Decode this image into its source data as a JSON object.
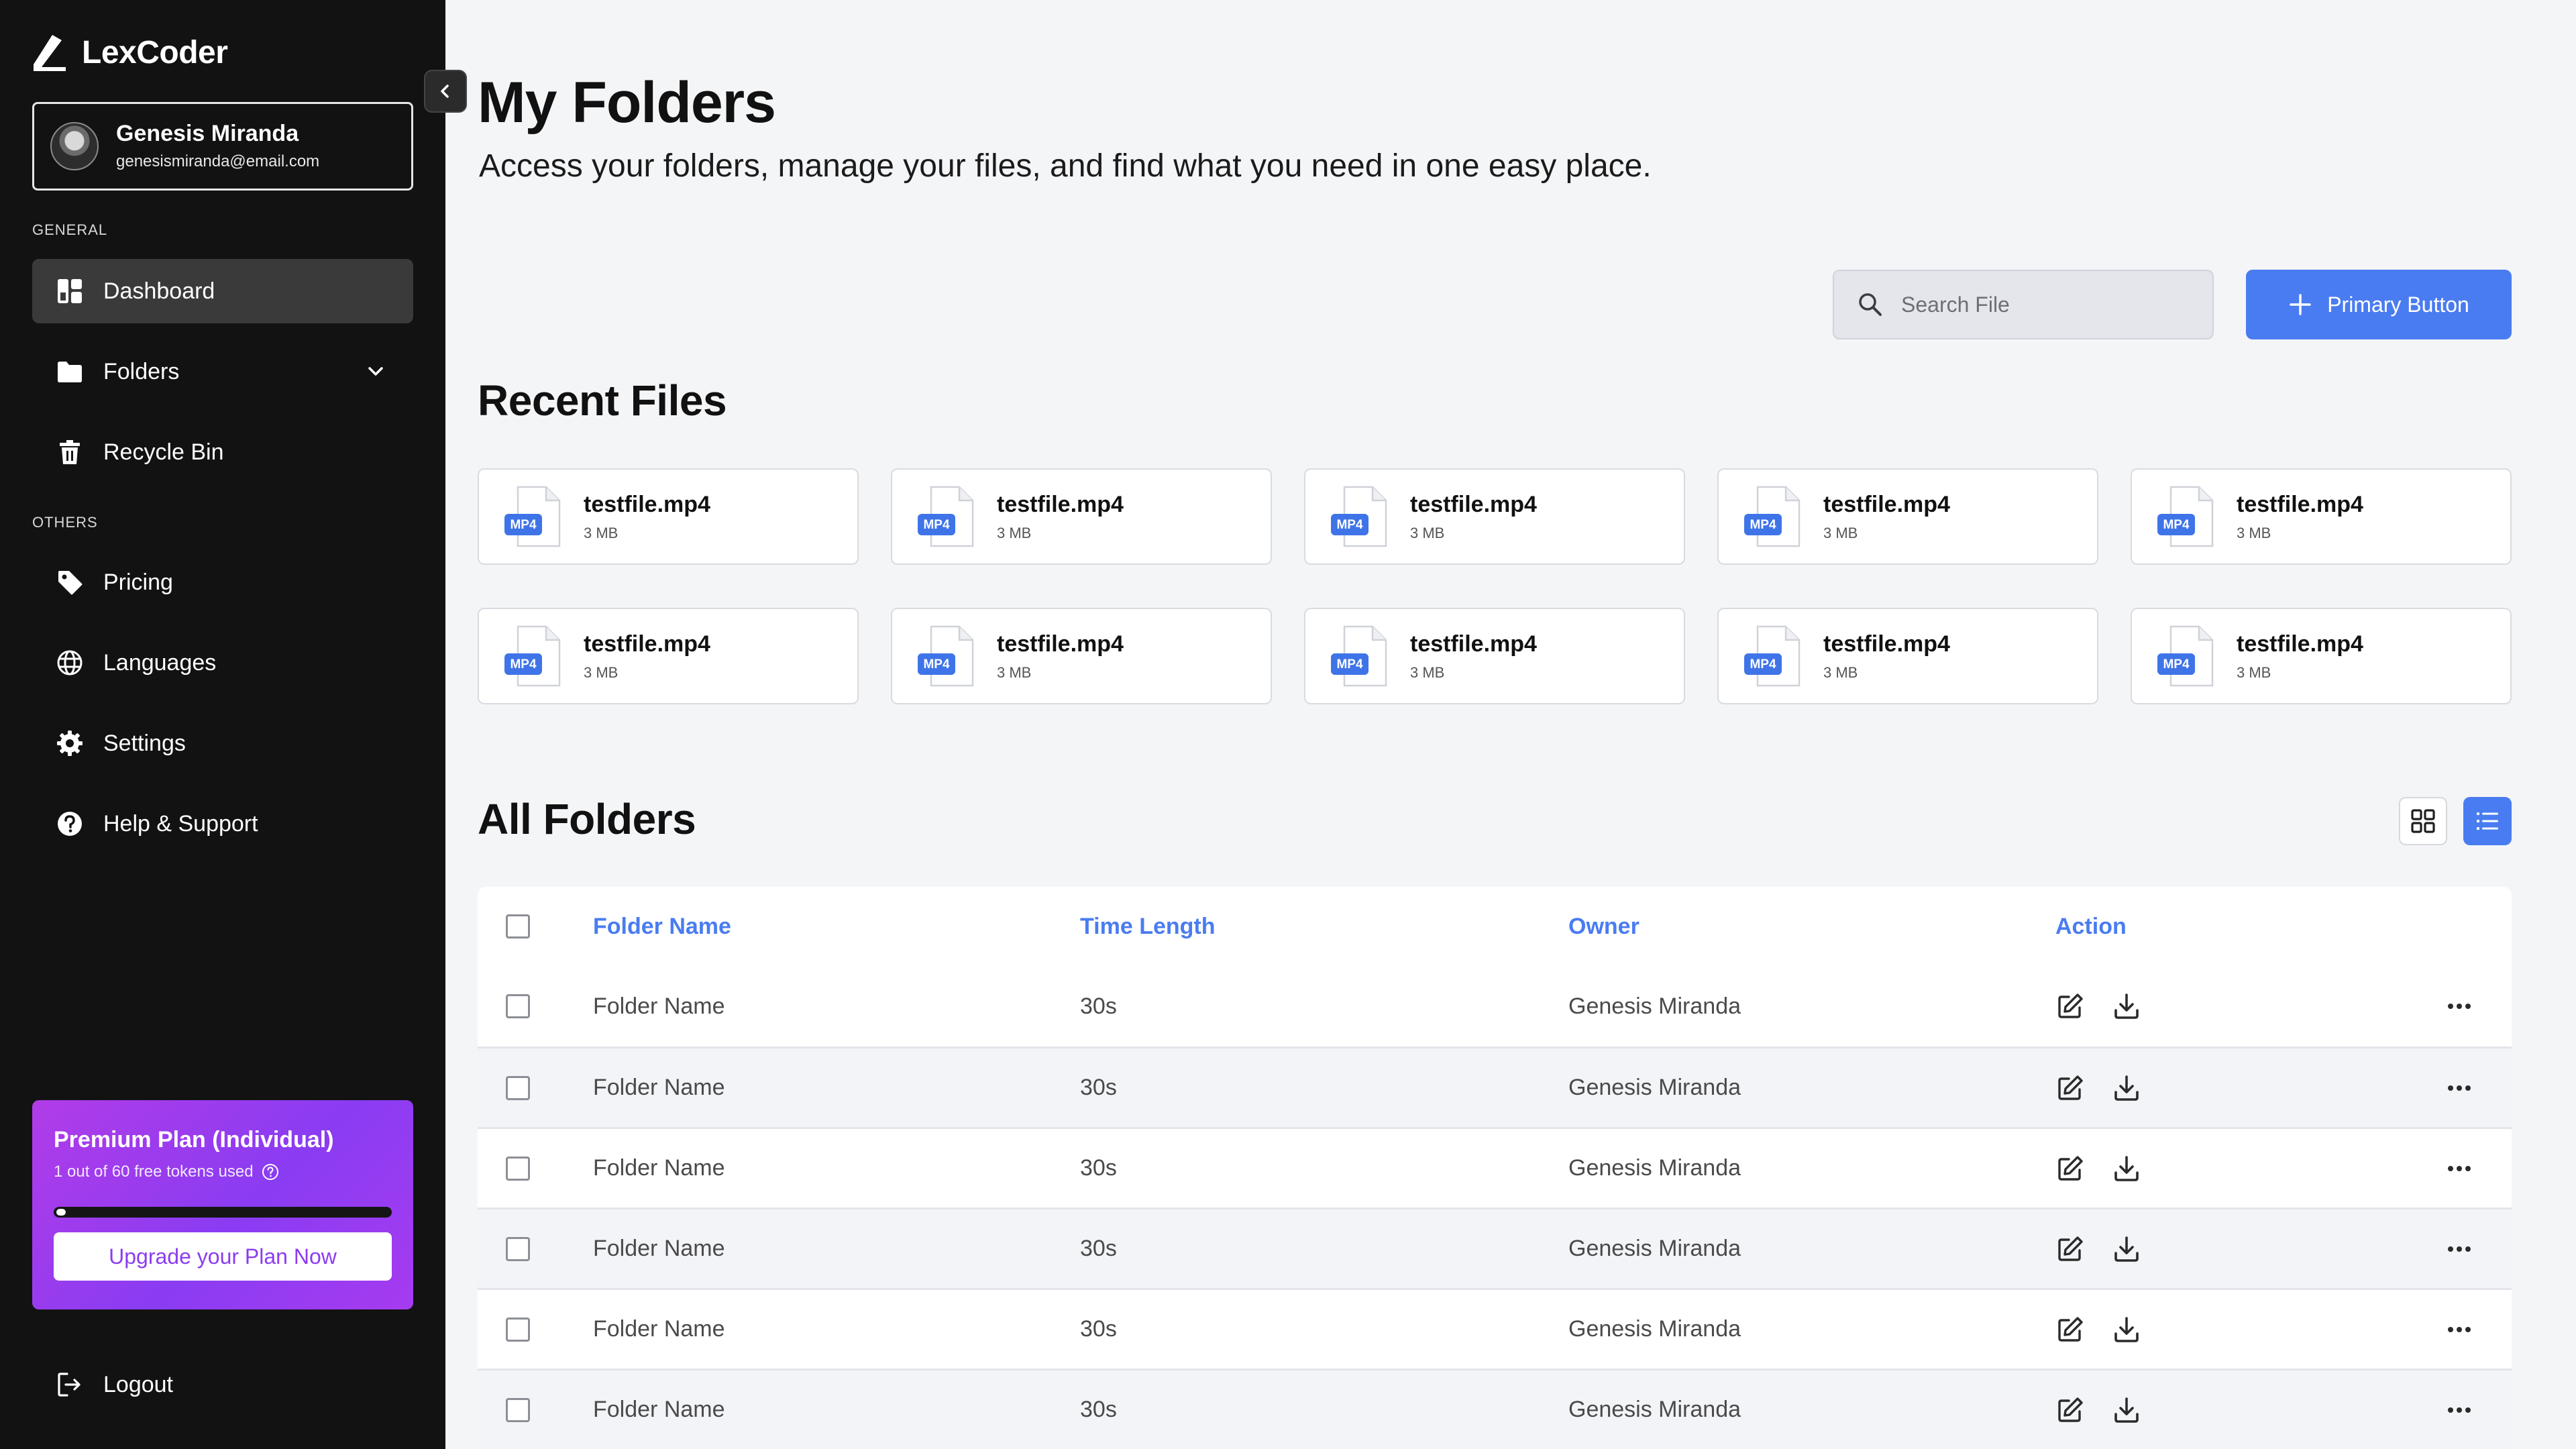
{
  "app": {
    "name": "LexCoder"
  },
  "user": {
    "name": "Genesis Miranda",
    "email": "genesismiranda@email.com"
  },
  "sidebar": {
    "general_label": "GENERAL",
    "others_label": "OTHERS",
    "items": [
      {
        "label": "Dashboard",
        "icon": "dashboard-icon",
        "active": true
      },
      {
        "label": "Folders",
        "icon": "folder-icon"
      },
      {
        "label": "Recycle Bin",
        "icon": "trash-icon"
      },
      {
        "label": "Pricing",
        "icon": "tag-icon"
      },
      {
        "label": "Languages",
        "icon": "globe-icon"
      },
      {
        "label": "Settings",
        "icon": "gear-icon"
      },
      {
        "label": "Help & Support",
        "icon": "help-icon"
      }
    ],
    "logout_label": "Logout"
  },
  "premium": {
    "title": "Premium Plan (Individual)",
    "usage_text": "1 out of 60 free tokens used",
    "tokens_used": 1,
    "tokens_total": 60,
    "button_label": "Upgrade your Plan Now"
  },
  "header": {
    "title": "My Folders",
    "subtitle": "Access your folders, manage your files, and find what you need in one easy place."
  },
  "search": {
    "placeholder": "Search File"
  },
  "primary_button": {
    "label": "Primary Button"
  },
  "recent_files": {
    "heading": "Recent Files",
    "badge": "MP4",
    "files": [
      {
        "name": "testfile.mp4",
        "size": "3 MB"
      },
      {
        "name": "testfile.mp4",
        "size": "3 MB"
      },
      {
        "name": "testfile.mp4",
        "size": "3 MB"
      },
      {
        "name": "testfile.mp4",
        "size": "3 MB"
      },
      {
        "name": "testfile.mp4",
        "size": "3 MB"
      },
      {
        "name": "testfile.mp4",
        "size": "3 MB"
      },
      {
        "name": "testfile.mp4",
        "size": "3 MB"
      },
      {
        "name": "testfile.mp4",
        "size": "3 MB"
      },
      {
        "name": "testfile.mp4",
        "size": "3 MB"
      },
      {
        "name": "testfile.mp4",
        "size": "3 MB"
      }
    ]
  },
  "folders": {
    "heading": "All Folders",
    "columns": [
      "Folder Name",
      "Time Length",
      "Owner",
      "Action"
    ],
    "rows": [
      {
        "name": "Folder Name",
        "length": "30s",
        "owner": "Genesis Miranda"
      },
      {
        "name": "Folder Name",
        "length": "30s",
        "owner": "Genesis Miranda"
      },
      {
        "name": "Folder Name",
        "length": "30s",
        "owner": "Genesis Miranda"
      },
      {
        "name": "Folder Name",
        "length": "30s",
        "owner": "Genesis Miranda"
      },
      {
        "name": "Folder Name",
        "length": "30s",
        "owner": "Genesis Miranda"
      },
      {
        "name": "Folder Name",
        "length": "30s",
        "owner": "Genesis Miranda"
      }
    ]
  },
  "colors": {
    "accent": "#4a7cf1",
    "sidebar_bg": "#121212",
    "premium_start": "#b13ce8",
    "premium_end": "#8a3cf2"
  }
}
